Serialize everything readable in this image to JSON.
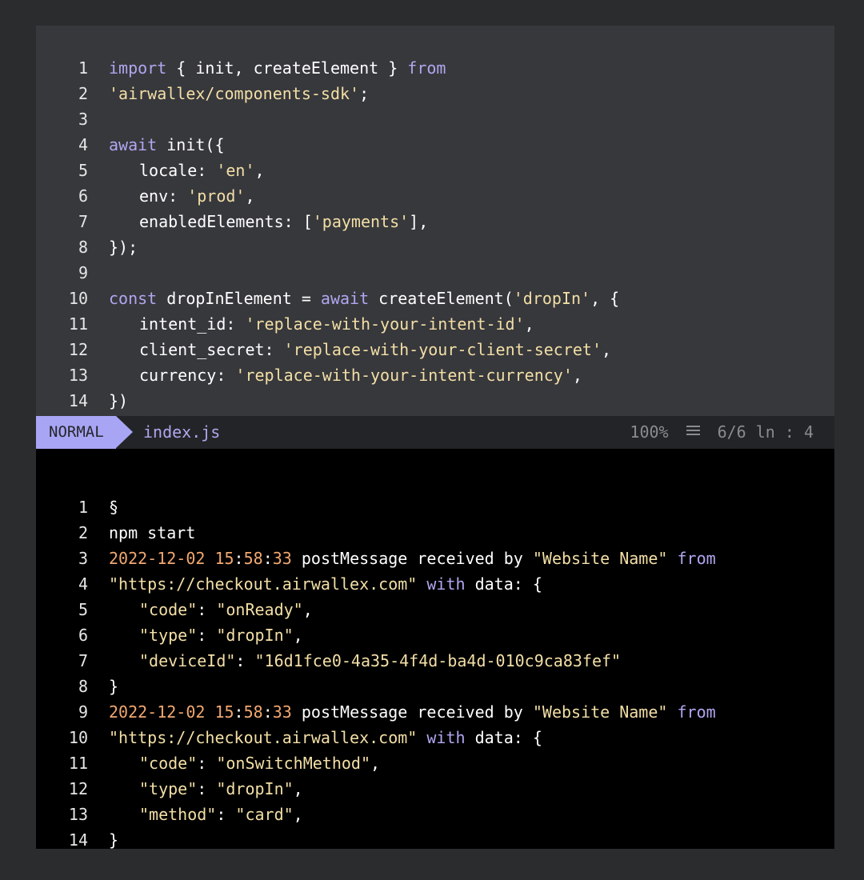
{
  "editor": {
    "lines": [
      {
        "n": "1",
        "parts": [
          {
            "t": "import",
            "c": "kw"
          },
          {
            "t": " { init, createElement } ",
            "c": "tx"
          },
          {
            "t": "from",
            "c": "kw"
          }
        ]
      },
      {
        "n": "2",
        "parts": [
          {
            "t": "'airwallex/components-sdk'",
            "c": "str"
          },
          {
            "t": ";",
            "c": "tx"
          }
        ]
      },
      {
        "n": "3",
        "parts": []
      },
      {
        "n": "4",
        "parts": [
          {
            "t": "await",
            "c": "kw"
          },
          {
            "t": " init({",
            "c": "tx"
          }
        ]
      },
      {
        "n": "5",
        "indent": true,
        "parts": [
          {
            "t": "locale: ",
            "c": "tx"
          },
          {
            "t": "'en'",
            "c": "str"
          },
          {
            "t": ",",
            "c": "tx"
          }
        ]
      },
      {
        "n": "6",
        "indent": true,
        "parts": [
          {
            "t": "env: ",
            "c": "tx"
          },
          {
            "t": "'prod'",
            "c": "str"
          },
          {
            "t": ",",
            "c": "tx"
          }
        ]
      },
      {
        "n": "7",
        "indent": true,
        "parts": [
          {
            "t": "enabledElements: [",
            "c": "tx"
          },
          {
            "t": "'payments'",
            "c": "str"
          },
          {
            "t": "],",
            "c": "tx"
          }
        ]
      },
      {
        "n": "8",
        "parts": [
          {
            "t": "});",
            "c": "tx"
          }
        ]
      },
      {
        "n": "9",
        "parts": []
      },
      {
        "n": "10",
        "parts": [
          {
            "t": "const",
            "c": "kw"
          },
          {
            "t": " dropInElement = ",
            "c": "tx"
          },
          {
            "t": "await",
            "c": "kw"
          },
          {
            "t": " createElement(",
            "c": "tx"
          },
          {
            "t": "'dropIn'",
            "c": "str"
          },
          {
            "t": ", {",
            "c": "tx"
          }
        ]
      },
      {
        "n": "11",
        "indent": true,
        "parts": [
          {
            "t": "intent_id: ",
            "c": "tx"
          },
          {
            "t": "'replace-with-your-intent-id'",
            "c": "str"
          },
          {
            "t": ",",
            "c": "tx"
          }
        ]
      },
      {
        "n": "12",
        "indent": true,
        "parts": [
          {
            "t": "client_secret: ",
            "c": "tx"
          },
          {
            "t": "'replace-with-your-client-secret'",
            "c": "str"
          },
          {
            "t": ",",
            "c": "tx"
          }
        ]
      },
      {
        "n": "13",
        "indent": true,
        "parts": [
          {
            "t": "currency: ",
            "c": "tx"
          },
          {
            "t": "'replace-with-your-intent-currency'",
            "c": "str"
          },
          {
            "t": ",",
            "c": "tx"
          }
        ]
      },
      {
        "n": "14",
        "parts": [
          {
            "t": "})",
            "c": "tx"
          }
        ]
      }
    ]
  },
  "statusbar": {
    "mode": "NORMAL",
    "filename": "index.js",
    "percent": "100%",
    "position": "6/6 ln : 4",
    "icon": "menu-lines-icon"
  },
  "terminal": {
    "lines": [
      {
        "n": "1",
        "parts": [
          {
            "t": "§",
            "c": "tx"
          }
        ]
      },
      {
        "n": "2",
        "parts": [
          {
            "t": "npm start",
            "c": "tx"
          }
        ]
      },
      {
        "n": "3",
        "parts": [
          {
            "t": "2022-12-02 15",
            "c": "ts"
          },
          {
            "t": ":",
            "c": "tx"
          },
          {
            "t": "58",
            "c": "ts"
          },
          {
            "t": ":",
            "c": "tx"
          },
          {
            "t": "33",
            "c": "ts"
          },
          {
            "t": " postMessage received by ",
            "c": "tx"
          },
          {
            "t": "\"Website Name\"",
            "c": "str"
          },
          {
            "t": " ",
            "c": "tx"
          },
          {
            "t": "from",
            "c": "kw"
          }
        ]
      },
      {
        "n": "4",
        "parts": [
          {
            "t": "\"https://checkout.airwallex.com\"",
            "c": "str"
          },
          {
            "t": " ",
            "c": "tx"
          },
          {
            "t": "with",
            "c": "kw"
          },
          {
            "t": " data: {",
            "c": "tx"
          }
        ]
      },
      {
        "n": "5",
        "indent": true,
        "parts": [
          {
            "t": "\"code\"",
            "c": "str"
          },
          {
            "t": ": ",
            "c": "tx"
          },
          {
            "t": "\"onReady\"",
            "c": "str"
          },
          {
            "t": ",",
            "c": "tx"
          }
        ]
      },
      {
        "n": "6",
        "indent": true,
        "parts": [
          {
            "t": "\"type\"",
            "c": "str"
          },
          {
            "t": ": ",
            "c": "tx"
          },
          {
            "t": "\"dropIn\"",
            "c": "str"
          },
          {
            "t": ",",
            "c": "tx"
          }
        ]
      },
      {
        "n": "7",
        "indent": true,
        "parts": [
          {
            "t": "\"deviceId\"",
            "c": "str"
          },
          {
            "t": ": ",
            "c": "tx"
          },
          {
            "t": "\"16d1fce0-4a35-4f4d-ba4d-010c9ca83fef\"",
            "c": "str"
          }
        ]
      },
      {
        "n": "8",
        "parts": [
          {
            "t": "}",
            "c": "tx"
          }
        ]
      },
      {
        "n": "9",
        "parts": [
          {
            "t": "2022-12-02 15",
            "c": "ts"
          },
          {
            "t": ":",
            "c": "tx"
          },
          {
            "t": "58",
            "c": "ts"
          },
          {
            "t": ":",
            "c": "tx"
          },
          {
            "t": "33",
            "c": "ts"
          },
          {
            "t": " postMessage received by ",
            "c": "tx"
          },
          {
            "t": "\"Website Name\"",
            "c": "str"
          },
          {
            "t": " ",
            "c": "tx"
          },
          {
            "t": "from",
            "c": "kw"
          }
        ]
      },
      {
        "n": "10",
        "parts": [
          {
            "t": "\"https://checkout.airwallex.com\"",
            "c": "str"
          },
          {
            "t": " ",
            "c": "tx"
          },
          {
            "t": "with",
            "c": "kw"
          },
          {
            "t": " data: {",
            "c": "tx"
          }
        ]
      },
      {
        "n": "11",
        "indent": true,
        "parts": [
          {
            "t": "\"code\"",
            "c": "str"
          },
          {
            "t": ": ",
            "c": "tx"
          },
          {
            "t": "\"onSwitchMethod\"",
            "c": "str"
          },
          {
            "t": ",",
            "c": "tx"
          }
        ]
      },
      {
        "n": "12",
        "indent": true,
        "parts": [
          {
            "t": "\"type\"",
            "c": "str"
          },
          {
            "t": ": ",
            "c": "tx"
          },
          {
            "t": "\"dropIn\"",
            "c": "str"
          },
          {
            "t": ",",
            "c": "tx"
          }
        ]
      },
      {
        "n": "13",
        "indent": true,
        "parts": [
          {
            "t": "\"method\"",
            "c": "str"
          },
          {
            "t": ": ",
            "c": "tx"
          },
          {
            "t": "\"card\"",
            "c": "str"
          },
          {
            "t": ",",
            "c": "tx"
          }
        ]
      },
      {
        "n": "14",
        "parts": [
          {
            "t": "}",
            "c": "tx"
          }
        ]
      }
    ]
  },
  "colors": {
    "editor_bg": "#37383c",
    "terminal_bg": "#000000",
    "keyword": "#b1a6f0",
    "string": "#f3dfa6",
    "timestamp": "#f2a870",
    "mode_badge": "#a8a5f5"
  }
}
